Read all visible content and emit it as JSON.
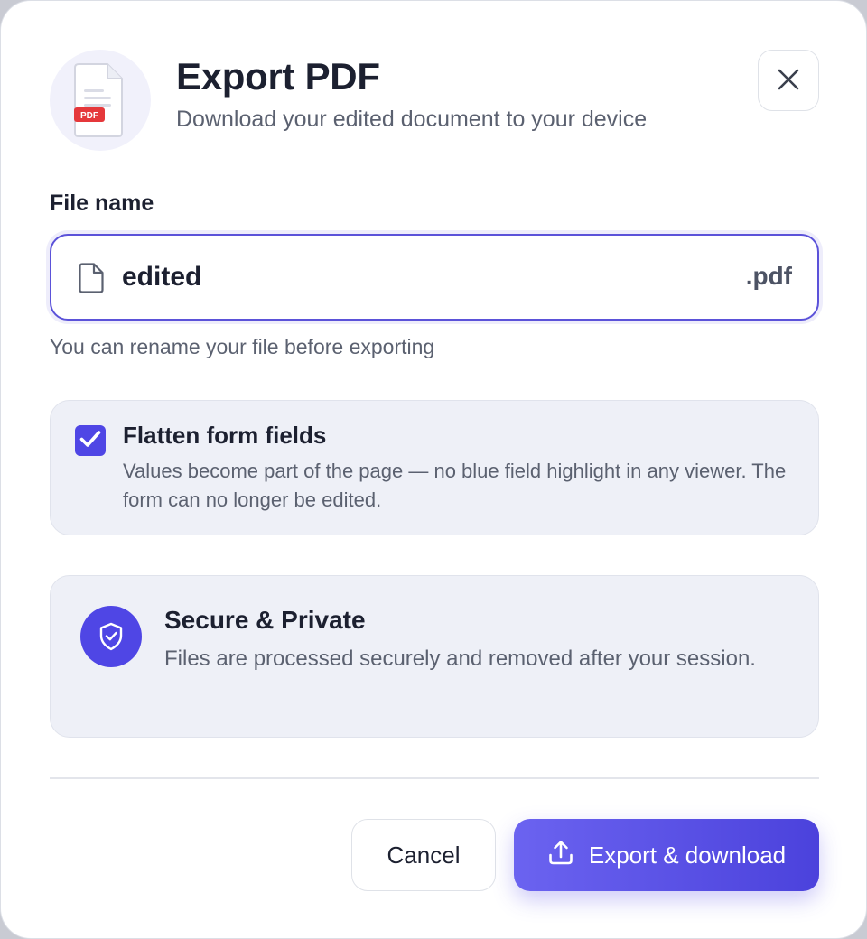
{
  "header": {
    "title": "Export PDF",
    "subtitle": "Download your edited document to your device",
    "badge_text": "PDF",
    "close_icon": "close-icon"
  },
  "file_name": {
    "label": "File name",
    "value": "edited",
    "extension": ".pdf",
    "hint": "You can rename your file before exporting"
  },
  "flatten": {
    "checked": true,
    "title": "Flatten form fields",
    "description": "Values become part of the page — no blue field highlight in any viewer. The form can no longer be edited."
  },
  "secure": {
    "title": "Secure & Private",
    "description": "Files are processed securely and removed after your session."
  },
  "footer": {
    "cancel_label": "Cancel",
    "export_label": "Export & download"
  },
  "colors": {
    "accent": "#4f46e5",
    "badge_red": "#e5383b",
    "text_primary": "#1c2030",
    "text_secondary": "#5b6170",
    "card_bg": "#eef0f7"
  }
}
